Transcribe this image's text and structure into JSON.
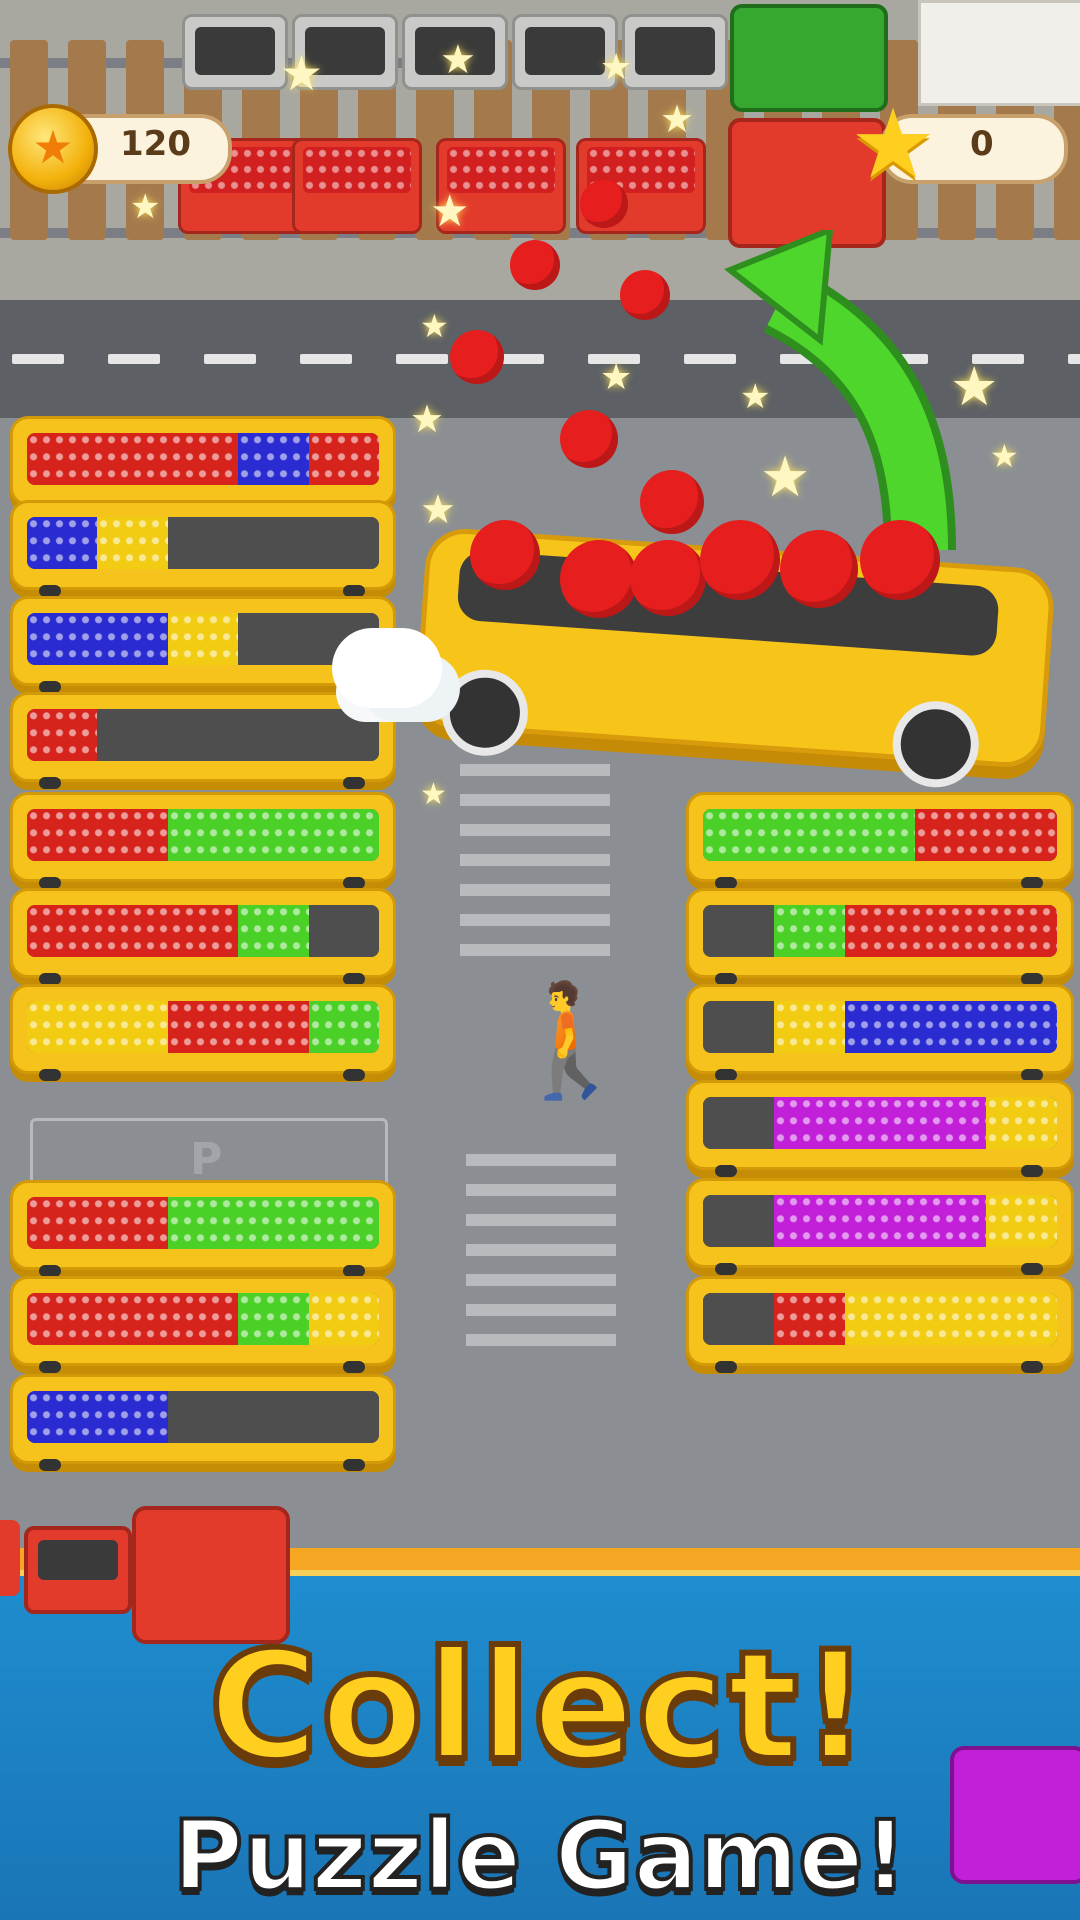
{
  "hud": {
    "coins": "120",
    "stars": "0",
    "coin_icon": "coin-star-icon",
    "star_icon": "star-icon"
  },
  "colors": {
    "red": "#d6231c",
    "blue": "#2a2bd0",
    "yellow": "#f1cc12",
    "green": "#4bd028",
    "magenta": "#c21fd9",
    "empty": "#4e4e4e"
  },
  "left_buses": [
    {
      "segments": [
        [
          "red",
          15
        ],
        [
          "blue",
          5
        ],
        [
          "red",
          5
        ]
      ]
    },
    {
      "segments": [
        [
          "blue",
          5
        ],
        [
          "yellow",
          5
        ],
        [
          "empty",
          15
        ]
      ]
    },
    {
      "segments": [
        [
          "blue",
          10
        ],
        [
          "yellow",
          5
        ],
        [
          "empty",
          10
        ]
      ]
    },
    {
      "segments": [
        [
          "red",
          5
        ],
        [
          "empty",
          20
        ]
      ]
    },
    {
      "segments": [
        [
          "red",
          10
        ],
        [
          "green",
          15
        ]
      ]
    },
    {
      "segments": [
        [
          "red",
          15
        ],
        [
          "green",
          5
        ],
        [
          "empty",
          5
        ]
      ]
    },
    {
      "segments": [
        [
          "yellow",
          10
        ],
        [
          "red",
          10
        ],
        [
          "green",
          5
        ]
      ]
    },
    {
      "segments": [
        [
          "red",
          10
        ],
        [
          "green",
          15
        ]
      ]
    },
    {
      "segments": [
        [
          "red",
          15
        ],
        [
          "green",
          5
        ],
        [
          "yellow",
          5
        ]
      ]
    },
    {
      "segments": [
        [
          "blue",
          10
        ],
        [
          "empty",
          15
        ]
      ]
    }
  ],
  "right_buses": [
    {
      "segments": [
        [
          "green",
          15
        ],
        [
          "red",
          10
        ]
      ]
    },
    {
      "segments": [
        [
          "empty",
          5
        ],
        [
          "green",
          5
        ],
        [
          "red",
          15
        ]
      ]
    },
    {
      "segments": [
        [
          "empty",
          5
        ],
        [
          "yellow",
          5
        ],
        [
          "blue",
          15
        ]
      ]
    },
    {
      "segments": [
        [
          "empty",
          5
        ],
        [
          "magenta",
          15
        ],
        [
          "yellow",
          5
        ]
      ]
    },
    {
      "segments": [
        [
          "empty",
          5
        ],
        [
          "magenta",
          15
        ],
        [
          "yellow",
          5
        ]
      ]
    },
    {
      "segments": [
        [
          "empty",
          5
        ],
        [
          "red",
          5
        ],
        [
          "yellow",
          15
        ]
      ]
    }
  ],
  "parking_label": "P",
  "banner": {
    "headline": "Collect!",
    "subline": "Puzzle Game!"
  }
}
